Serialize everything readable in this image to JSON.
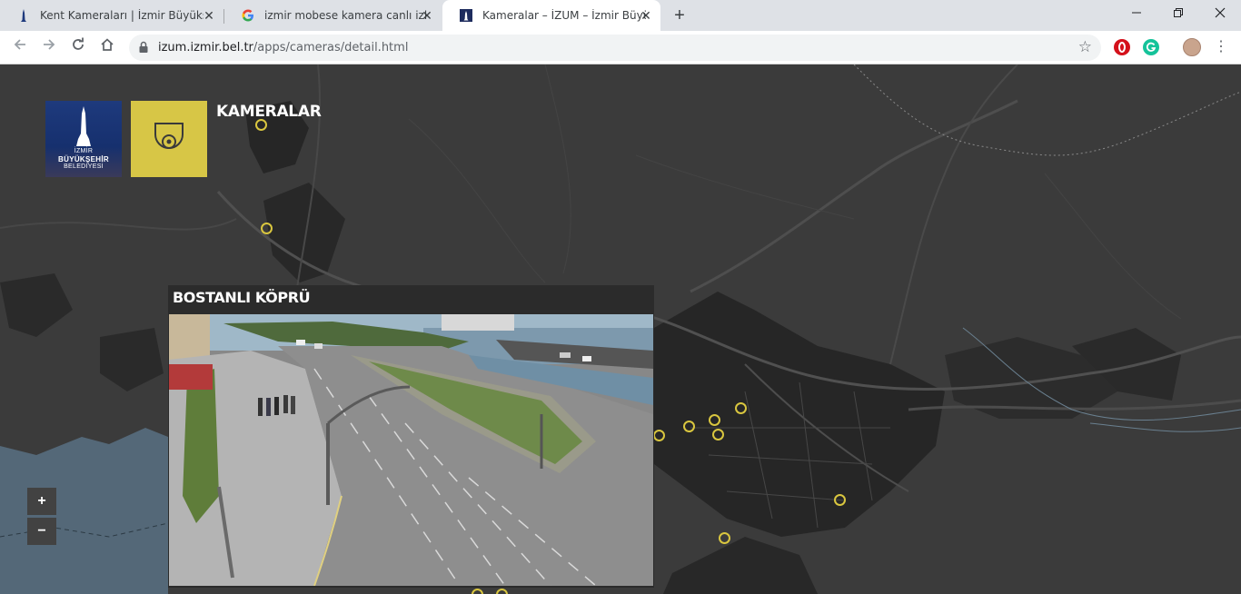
{
  "browser": {
    "tabs": [
      {
        "title": "Kent Kameraları | İzmir Büyükşehir",
        "favicon": "izmir-tower-icon",
        "active": false
      },
      {
        "title": "izmir mobese kamera canlı izle - Go",
        "favicon": "google-icon",
        "active": false
      },
      {
        "title": "Kameralar – İZUM – İzmir Büyükşehir",
        "favicon": "izmir-tower-icon",
        "active": true
      }
    ],
    "new_tab_label": "+",
    "url_host": "izum.izmir.bel.tr",
    "url_path": "/apps/cameras/detail.html"
  },
  "app": {
    "logo_lines": [
      "İZMİR",
      "BÜYÜKŞEHİR",
      "BELEDİYESİ"
    ],
    "title": "KAMERALAR",
    "accent_color": "#d7c646",
    "marker_color": "#d9c63f"
  },
  "zoom": {
    "in_label": "+",
    "out_label": "−"
  },
  "popup": {
    "camera_name": "BOSTANLI KÖPRÜ"
  }
}
